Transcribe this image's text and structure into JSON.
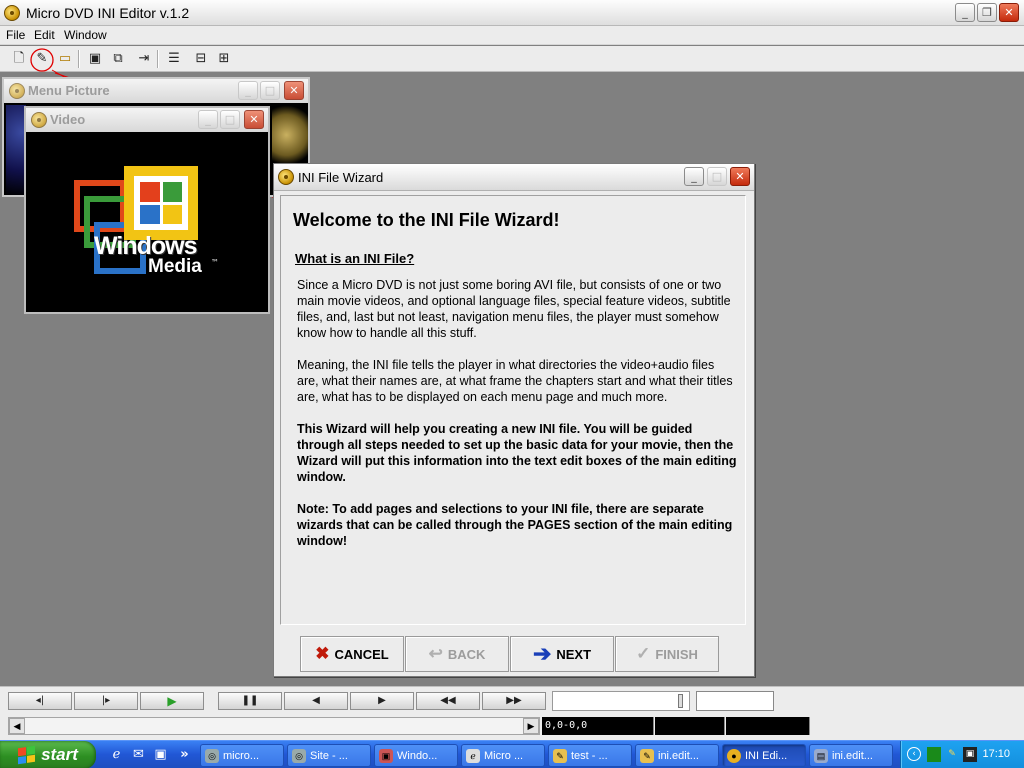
{
  "app": {
    "title": "Micro DVD INI Editor v.1.2",
    "menu": [
      "File",
      "Edit",
      "Window"
    ]
  },
  "windows": {
    "menu_picture_title": "Menu Picture",
    "video_title": "Video",
    "video_logo_line1": "Windows",
    "video_logo_line2": "Media",
    "video_logo_tm": "™"
  },
  "wizard": {
    "title": "INI File Wizard",
    "heading": "Welcome to the INI File Wizard!",
    "subheading": "What is an INI File?",
    "para1": "Since a Micro DVD is not just some boring AVI file, but consists of one or two main movie videos, and optional language files, special feature videos, subtitle files,  and, last but not least, navigation menu files, the player must somehow know how to handle all this stuff.",
    "para2": "Meaning, the INI file tells the player in what directories the video+audio files are, what their names are, at what frame the chapters start and what their titles are, what has to be displayed on each menu page and much more.",
    "para3": "This Wizard will help you creating a new INI file. You will be guided through all steps needed to set up the basic data for your movie, then the Wizard will put this information into the text edit boxes of the main editing window.",
    "para4": "Note: To add pages and selections to your INI file, there are separate wizards that can be called through the PAGES section of the main editing window!",
    "buttons": {
      "cancel": "CANCEL",
      "back": "BACK",
      "next": "NEXT",
      "finish": "FINISH"
    }
  },
  "player": {
    "timecode": "0,0-0,0",
    "seek_position": 0.97
  },
  "taskbar": {
    "start_label": "start",
    "tasks": [
      "micro...",
      "Site - ...",
      "Windo...",
      "Micro ...",
      "test - ...",
      "ini.edit...",
      "INI Edi...",
      "ini.edit..."
    ],
    "active_task": "INI Edi...",
    "clock": "17:10"
  },
  "colors": {
    "taskbar_blue": "#2157d5",
    "start_green": "#2d8f22",
    "close_red": "#c42a0c",
    "annotation_red": "#e00000"
  }
}
